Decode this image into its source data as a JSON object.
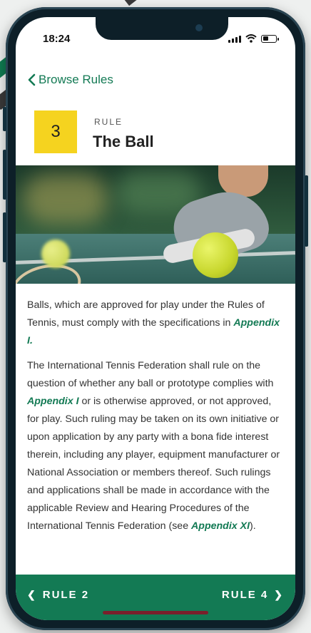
{
  "status_bar": {
    "time": "18:24",
    "battery_level": 0.45
  },
  "nav": {
    "back_label": "Browse Rules",
    "back_icon": "chevron-left-icon"
  },
  "rule": {
    "number": "3",
    "kicker": "RULE",
    "title": "The Ball"
  },
  "hero_image": {
    "subject": "tennis ball on court",
    "colors": {
      "ball": "#d6e23a",
      "court": "#3f6f68"
    }
  },
  "body": {
    "p1_text": "Balls, which are approved for play under the Rules of Tennis, must comply with the specifications in ",
    "p1_link": "Appendix I.",
    "p2_text_a": "The International Tennis Federation shall rule on the question of whether any ball or prototype complies with ",
    "p2_link_a": "Appendix I",
    "p2_text_b": " or is otherwise approved, or not approved, for play. Such ruling may be taken on its own initiative or upon application by any party with a bona fide interest therein, including any player, equipment manufacturer or National Association or members thereof. Such rulings and applications shall be made in accordance with the applicable Review and Hearing Procedures of the International Tennis Federation (see ",
    "p2_link_b": "Appendix XI",
    "p2_text_c": ")."
  },
  "footer": {
    "prev_label": "RULE 2",
    "next_label": "RULE 4",
    "prev_icon": "chevron-left-icon",
    "next_icon": "chevron-right-icon"
  },
  "colors": {
    "accent": "#137a54",
    "badge": "#f5d31f",
    "frame": "#0d1f28"
  }
}
